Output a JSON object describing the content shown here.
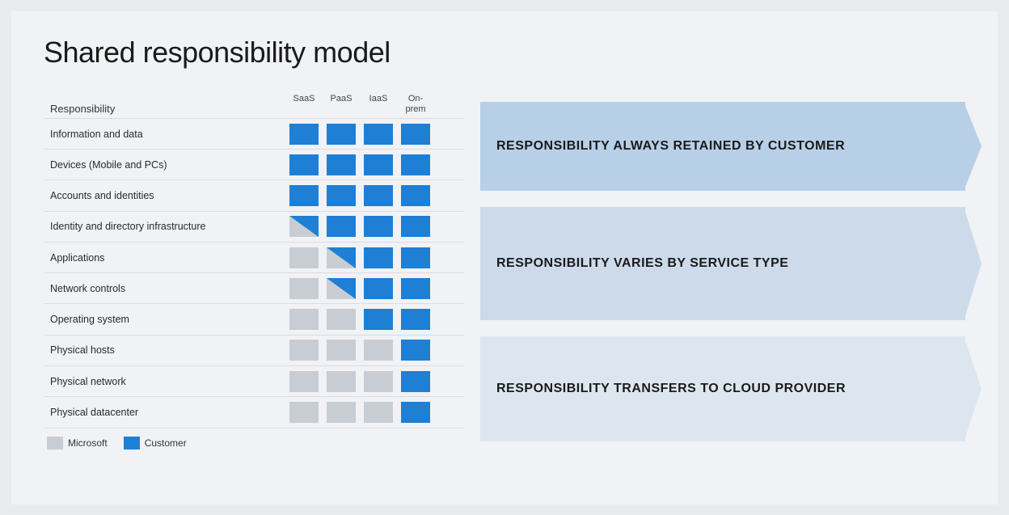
{
  "slide": {
    "title": "Shared responsibility model",
    "table": {
      "header": {
        "responsibility_label": "Responsibility",
        "columns": [
          "SaaS",
          "PaaS",
          "IaaS",
          "On-prem"
        ]
      },
      "rows": [
        {
          "label": "Information and data",
          "cells": [
            "blue",
            "blue",
            "blue",
            "blue"
          ]
        },
        {
          "label": "Devices (Mobile and PCs)",
          "cells": [
            "blue",
            "blue",
            "blue",
            "blue"
          ]
        },
        {
          "label": "Accounts and identities",
          "cells": [
            "blue",
            "blue",
            "blue",
            "blue"
          ]
        },
        {
          "label": "Identity and directory infrastructure",
          "cells": [
            "half-blue-right",
            "blue",
            "blue",
            "blue"
          ]
        },
        {
          "label": "Applications",
          "cells": [
            "gray",
            "half-blue-right",
            "blue",
            "blue"
          ]
        },
        {
          "label": "Network controls",
          "cells": [
            "gray",
            "half-blue-right",
            "blue",
            "blue"
          ]
        },
        {
          "label": "Operating system",
          "cells": [
            "gray",
            "gray",
            "blue",
            "blue"
          ]
        },
        {
          "label": "Physical hosts",
          "cells": [
            "gray",
            "gray",
            "gray",
            "blue"
          ]
        },
        {
          "label": "Physical network",
          "cells": [
            "gray",
            "gray",
            "gray",
            "blue"
          ]
        },
        {
          "label": "Physical datacenter",
          "cells": [
            "gray",
            "gray",
            "gray",
            "blue"
          ]
        }
      ]
    },
    "banners": [
      {
        "text": "RESPONSIBILITY ALWAYS RETAINED BY CUSTOMER",
        "color": "#b8cfe8",
        "rows": 3
      },
      {
        "text": "RESPONSIBILITY VARIES BY SERVICE TYPE",
        "color": "#cddaea",
        "rows": 4
      },
      {
        "text": "RESPONSIBILITY TRANSFERS TO CLOUD PROVIDER",
        "color": "#dde6ef",
        "rows": 3
      }
    ],
    "legend": {
      "microsoft_label": "Microsoft",
      "customer_label": "Customer"
    }
  }
}
